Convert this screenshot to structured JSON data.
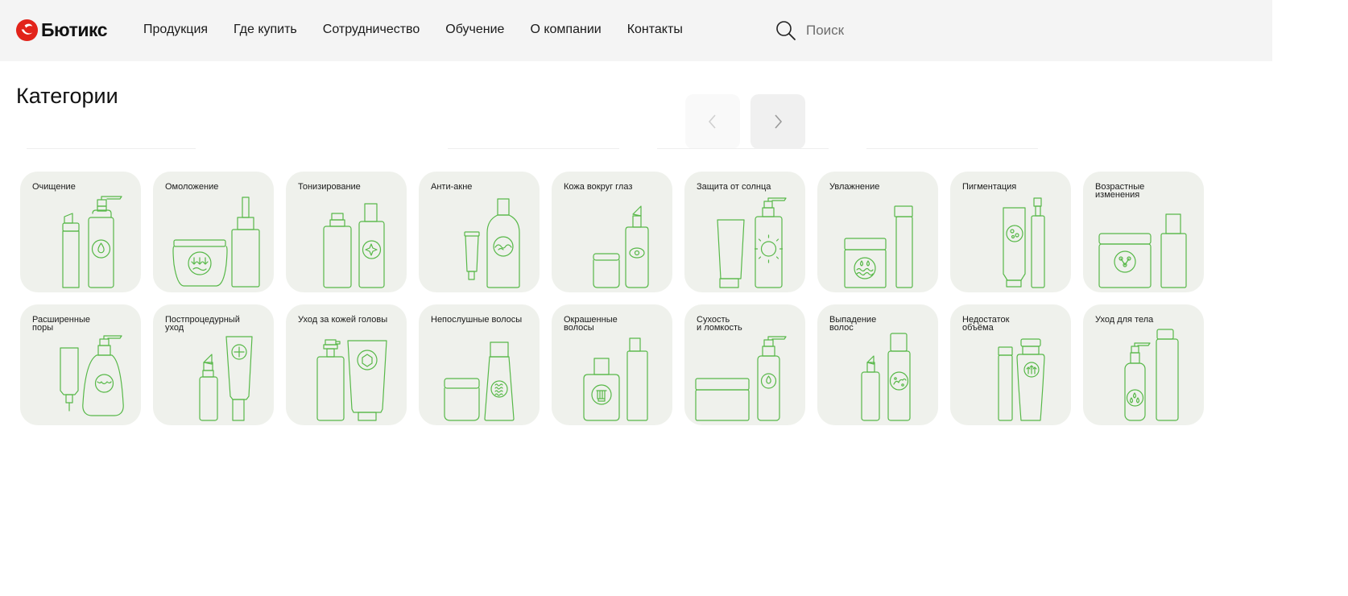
{
  "brand": {
    "name": "Бютикс",
    "accent": "#e2231a",
    "icon_color": "#57b848"
  },
  "nav": {
    "items": [
      "Продукция",
      "Где купить",
      "Сотрудничество",
      "Обучение",
      "О компании",
      "Контакты"
    ]
  },
  "search": {
    "placeholder": "Поиск",
    "icon": "search-icon"
  },
  "page": {
    "title": "Категории"
  },
  "slider": {
    "prev_icon": "chevron-left-icon",
    "next_icon": "chevron-right-icon"
  },
  "categories": [
    {
      "label": "Очищение",
      "icon": "cleansing-icon"
    },
    {
      "label": "Омоложение",
      "icon": "rejuvenation-icon"
    },
    {
      "label": "Тонизирование",
      "icon": "toning-icon"
    },
    {
      "label": "Анти-акне",
      "icon": "anti-acne-icon"
    },
    {
      "label": "Кожа вокруг глаз",
      "icon": "eye-skin-icon"
    },
    {
      "label": "Защита от солнца",
      "icon": "sun-protection-icon"
    },
    {
      "label": "Увлажнение",
      "icon": "moisturizing-icon"
    },
    {
      "label": "Пигментация",
      "icon": "pigmentation-icon"
    },
    {
      "label": "Возрастные\nизменения",
      "icon": "age-changes-icon"
    },
    {
      "label": "Расширенные\nпоры",
      "icon": "enlarged-pores-icon"
    },
    {
      "label": "Постпроцедурный\nуход",
      "icon": "post-procedure-icon"
    },
    {
      "label": "Уход за кожей головы",
      "icon": "scalp-care-icon"
    },
    {
      "label": "Непослушные волосы",
      "icon": "unruly-hair-icon"
    },
    {
      "label": "Окрашенные\nволосы",
      "icon": "colored-hair-icon"
    },
    {
      "label": "Сухость\nи ломкость",
      "icon": "dry-brittle-icon"
    },
    {
      "label": "Выпадение\nволос",
      "icon": "hair-loss-icon"
    },
    {
      "label": "Недостаток\nобъёма",
      "icon": "volume-icon"
    },
    {
      "label": "Уход для тела",
      "icon": "body-care-icon"
    }
  ]
}
